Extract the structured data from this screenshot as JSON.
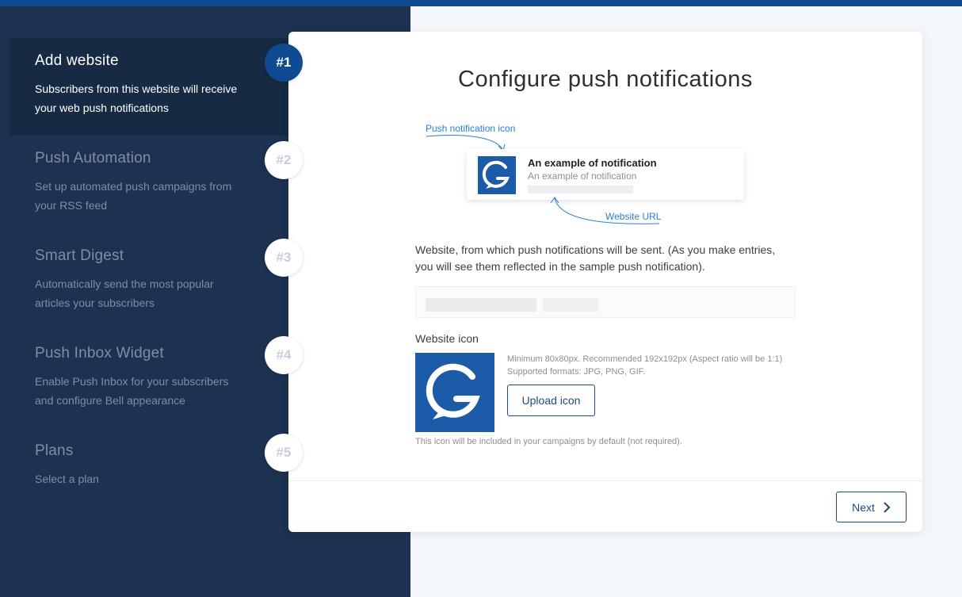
{
  "steps": [
    {
      "title": "Add website",
      "description": "Subscribers from this website will receive your web push notifications",
      "badge": "#1"
    },
    {
      "title": "Push Automation",
      "description": "Set up automated push campaigns from your RSS feed",
      "badge": "#2"
    },
    {
      "title": "Smart Digest",
      "description": "Automatically send the most popular articles your subscribers",
      "badge": "#3"
    },
    {
      "title": "Push Inbox Widget",
      "description": "Enable Push Inbox for your subscribers and configure Bell appearance",
      "badge": "#4"
    },
    {
      "title": "Plans",
      "description": "Select a plan",
      "badge": "#5"
    }
  ],
  "main": {
    "title": "Configure push notifications",
    "preview": {
      "icon_annotation": "Push notification icon",
      "url_annotation": "Website URL",
      "notification_title": "An example of notification",
      "notification_body": "An example of notification"
    },
    "website_description": "Website, from which push notifications will be sent. (As you make entries, you will see them reflected in the sample push notification).",
    "website_icon_label": "Website icon",
    "icon_requirements": "Minimum 80x80px. Recommended 192x192px (Aspect ratio will be 1:1) Supported formats: JPG, PNG, GIF.",
    "upload_label": "Upload icon",
    "icon_note": "This icon will be included in your campaigns by default (not required).",
    "next_label": "Next"
  },
  "colors": {
    "topbar": "#0f4a92",
    "sidebar": "#1d3150",
    "active_step": "#172a44",
    "accent": "#1d4a80",
    "annotation": "#2b7fd6"
  }
}
